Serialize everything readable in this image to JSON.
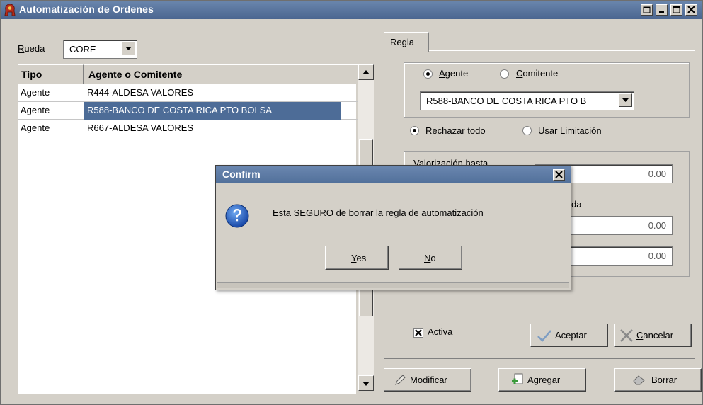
{
  "window": {
    "title": "Automatización de Ordenes"
  },
  "rueda": {
    "label": "Rueda",
    "value": "CORE"
  },
  "table": {
    "headers": [
      "Tipo",
      "Agente o Comitente"
    ],
    "rows": [
      {
        "tipo": "Agente",
        "agente": "R444-ALDESA VALORES"
      },
      {
        "tipo": "Agente",
        "agente": "R588-BANCO DE COSTA RICA PTO BOLSA"
      },
      {
        "tipo": "Agente",
        "agente": "R667-ALDESA VALORES"
      }
    ],
    "selected_index": 1
  },
  "tab": {
    "label": "Regla"
  },
  "regla": {
    "radio_agente": "Agente",
    "radio_comitente": "Comitente",
    "selected_type": "Agente",
    "agent_combo": "R588-BANCO DE COSTA RICA PTO B",
    "radio_rechazar": "Rechazar todo",
    "radio_usar": "Usar Limitación",
    "selected_mode": "Rechazar todo",
    "valorizacion_label": "Valorización hasta",
    "label2_partial": "da",
    "values": [
      "0.00",
      "0.00",
      "0.00"
    ],
    "activa_label": "Activa",
    "activa_checked": true,
    "aceptar": "Aceptar",
    "cancelar": "Cancelar"
  },
  "actions": {
    "modificar": "Modificar",
    "agregar": "Agregar",
    "borrar": "Borrar"
  },
  "dialog": {
    "title": "Confirm",
    "message": "Esta SEGURO de borrar la regla de automatización",
    "icon": "question-icon",
    "yes": "Yes",
    "no": "No"
  },
  "colors": {
    "titlebar": "#4f6b95",
    "selection": "#4d6c97",
    "face": "#d4d0c8"
  }
}
